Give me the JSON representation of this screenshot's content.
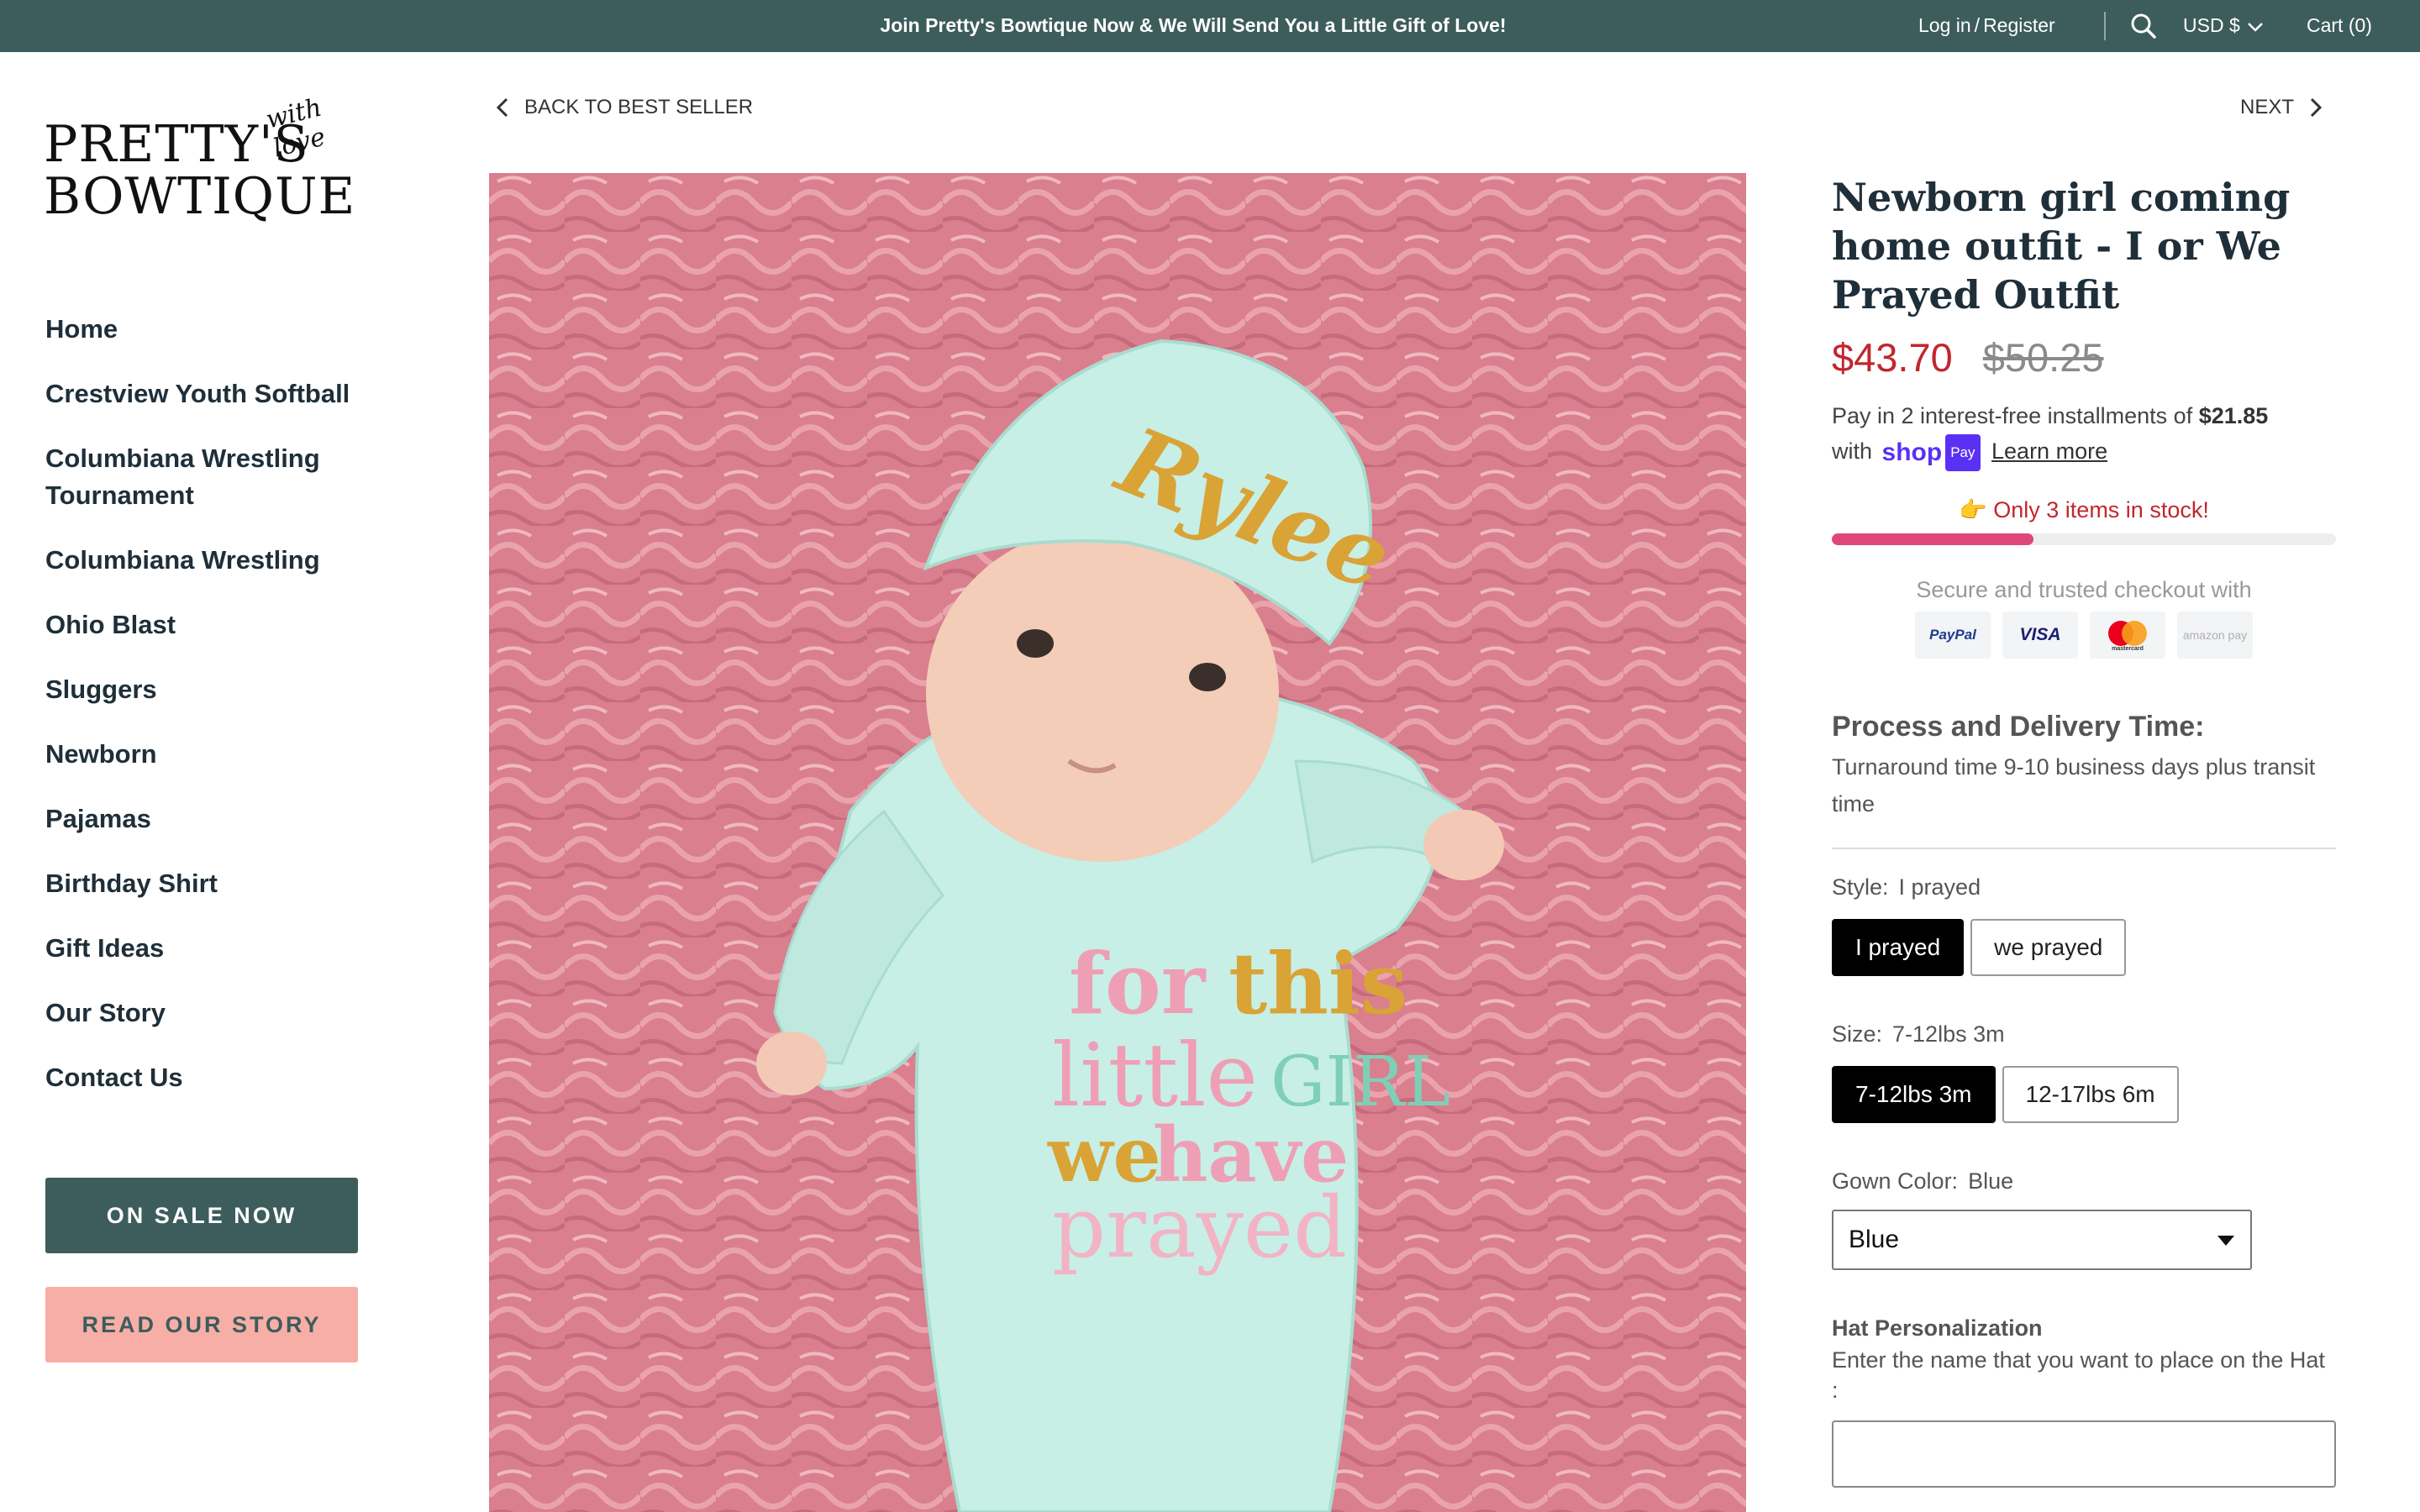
{
  "topbar": {
    "announcement": "Join Pretty's Bowtique Now & We Will Send You a Little Gift of Love!",
    "login": "Log in",
    "login_sep": "/",
    "register": "Register",
    "currency": "USD $",
    "cart": "Cart (0)"
  },
  "logo": {
    "line1": "PRETTY'S",
    "line2": "BOWTIQUE",
    "script": "with love"
  },
  "nav": [
    "Home",
    "Crestview Youth Softball",
    "Columbiana Wrestling Tournament",
    "Columbiana Wrestling",
    "Ohio Blast",
    "Sluggers",
    "Newborn",
    "Pajamas",
    "Birthday Shirt",
    "Gift Ideas",
    "Our Story",
    "Contact Us"
  ],
  "sidebar_buttons": {
    "sale": "ON SALE NOW",
    "story": "READ OUR STORY"
  },
  "pagination": {
    "back": "BACK TO BEST SELLER",
    "next": "NEXT"
  },
  "product_image": {
    "hat_name": "Rylee",
    "gown_text": [
      "for",
      "this",
      "little",
      "GIRL",
      "we",
      "have",
      "prayed"
    ]
  },
  "product": {
    "title": "Newborn girl coming home outfit - I or We Prayed Outfit",
    "price": "$43.70",
    "compare_price": "$50.25",
    "installments_text": "Pay in 2 interest-free installments of",
    "installment_amount": "$21.85",
    "with_text": "with",
    "shop_word": "shop",
    "shop_pay": "Pay",
    "learn_more": "Learn more",
    "stock_emoji": "👉",
    "stock_text": "Only 3 items in stock!",
    "stock_level": 0.4,
    "secure_text": "Secure and trusted checkout with",
    "payment_methods": [
      "PayPal",
      "VISA",
      "mastercard",
      "amazon pay"
    ]
  },
  "delivery": {
    "heading": "Process and Delivery Time:",
    "text": "Turnaround time 9-10 business days plus transit time"
  },
  "options": {
    "style": {
      "label": "Style:",
      "value": "I prayed",
      "choices": [
        "I prayed",
        "we prayed"
      ]
    },
    "size": {
      "label": "Size:",
      "value": "7-12lbs 3m",
      "choices": [
        "7-12lbs 3m",
        "12-17lbs 6m"
      ]
    },
    "gown_color": {
      "label": "Gown Color:",
      "value": "Blue",
      "selected": "Blue"
    }
  },
  "hat": {
    "heading": "Hat Personalization",
    "instructions": "Enter the name that you want to place on the Hat :"
  },
  "colors": {
    "brand": "#3d5c5c",
    "sale_red": "#c1272d",
    "story_pink": "#f7aea6",
    "shop_purple": "#5a31f4",
    "stock_bar": "#e0467c"
  }
}
